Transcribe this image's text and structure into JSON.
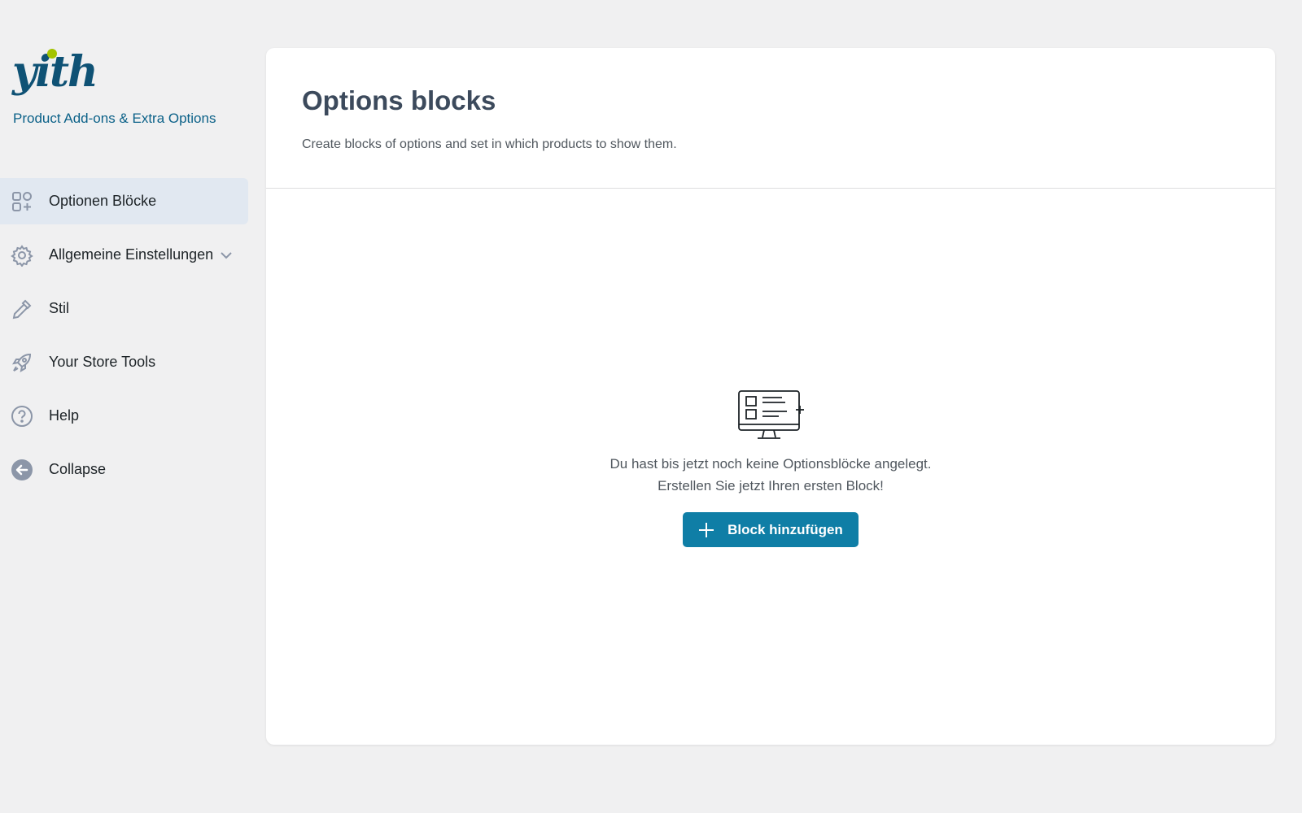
{
  "brand": {
    "logo_text": "yith",
    "plugin_name": "Product Add-ons & Extra Options",
    "logo_color": "#0f5275",
    "dot_color": "#a3c401"
  },
  "sidebar": {
    "items": [
      {
        "label": "Optionen Blöcke",
        "icon": "blocks-icon",
        "active": true
      },
      {
        "label": "Allgemeine Einstellungen",
        "icon": "gear-icon",
        "has_dropdown": true
      },
      {
        "label": "Stil",
        "icon": "pipette-icon"
      },
      {
        "label": "Your Store Tools",
        "icon": "rocket-icon"
      },
      {
        "label": "Help",
        "icon": "help-icon"
      },
      {
        "label": "Collapse",
        "icon": "collapse-arrow-icon"
      }
    ]
  },
  "main": {
    "title": "Options blocks",
    "description": "Create blocks of options and set in which products to show them.",
    "empty_state": {
      "icon": "monitor-list-icon",
      "line1": "Du hast bis jetzt noch keine Optionsblöcke angelegt.",
      "line2": "Erstellen Sie jetzt Ihren ersten Block!",
      "button_label": "Block hinzufügen"
    }
  },
  "colors": {
    "accent": "#0f7ea6",
    "active_bg": "#e1e8f1",
    "icon_gray": "#8c96a8"
  }
}
